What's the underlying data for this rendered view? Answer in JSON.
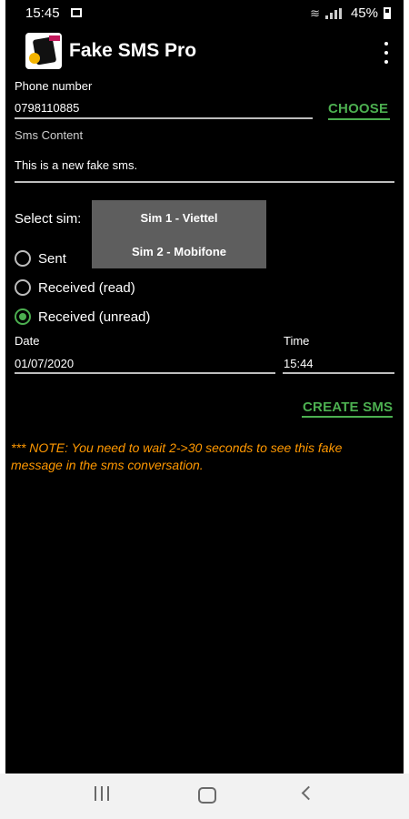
{
  "status_bar": {
    "time": "15:45",
    "battery": "45%"
  },
  "app_bar": {
    "title": "Fake SMS Pro"
  },
  "form": {
    "phone_label": "Phone number",
    "phone_value": "0798110885",
    "choose_label": "CHOOSE",
    "content_label": "Sms Content",
    "content_value": "This is a new fake sms.",
    "select_sim_label": "Select sim:",
    "sim_options": [
      "Sim 1 - Viettel",
      "Sim 2 - Mobifone"
    ],
    "radio_options": [
      {
        "label": "Sent",
        "checked": false
      },
      {
        "label": "Received (read)",
        "checked": false
      },
      {
        "label": "Received (unread)",
        "checked": true
      }
    ],
    "date_label": "Date",
    "date_value": "01/07/2020",
    "time_label": "Time",
    "time_value": "15:44",
    "create_label": "CREATE SMS"
  },
  "note": "*** NOTE: You need to wait 2->30 seconds to see this fake message in the sms conversation.",
  "colors": {
    "accent": "#4caf50",
    "note": "#ff9800",
    "background": "#000000"
  },
  "nav_bar": {
    "icons": [
      "recents-icon",
      "home-icon",
      "back-icon"
    ]
  }
}
